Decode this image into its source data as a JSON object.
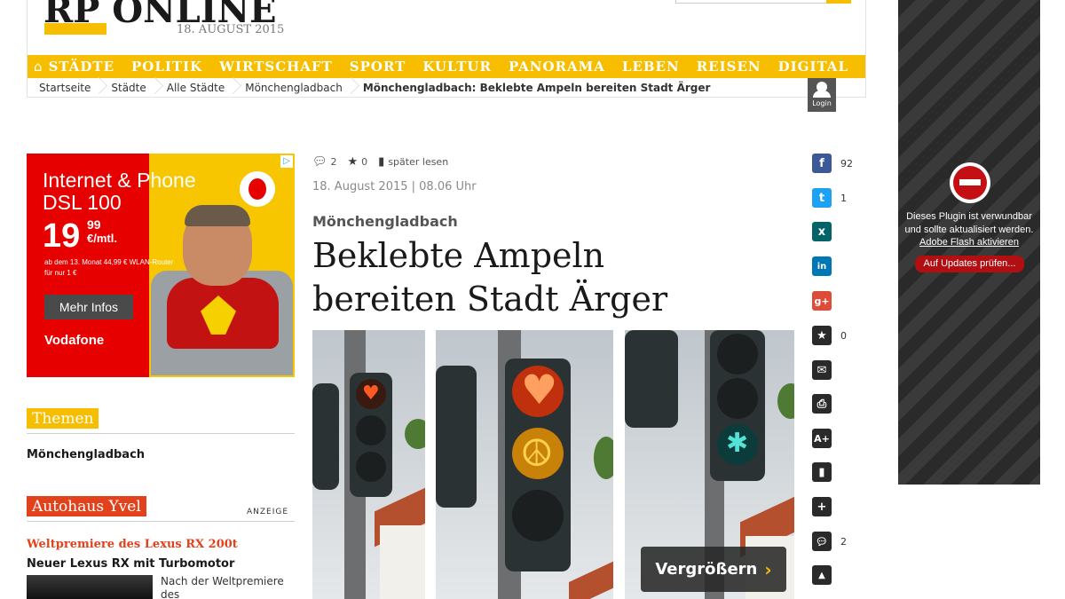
{
  "header": {
    "logo": "RP ONLINE",
    "date": "18. AUGUST 2015",
    "nav": [
      "STÄDTE",
      "POLITIK",
      "WIRTSCHAFT",
      "SPORT",
      "KULTUR",
      "PANORAMA",
      "LEBEN",
      "REISEN",
      "DIGITAL"
    ],
    "breadcrumb": [
      "Startseite",
      "Städte",
      "Alle Städte",
      "Mönchengladbach",
      "Mönchengladbach: Beklebte Ampeln bereiten Stadt Ärger"
    ],
    "login": "Login"
  },
  "ad": {
    "title": "Internet & Phone DSL 100",
    "price": "19",
    "cents": "99",
    "unit": "€/mtl.",
    "fineprint": "ab dem 13. Monat 44,99 € WLAN-Router für nur 1 €",
    "button": "Mehr Infos",
    "brand": "Vodafone"
  },
  "sidebar": {
    "themen_label": "Themen",
    "themen_link": "Mönchengladbach",
    "autohaus_label": "Autohaus Yvel",
    "anzeige": "ANZEIGE",
    "ad_title": "Weltpremiere des Lexus RX 200t",
    "ad_subtitle": "Neuer Lexus RX mit Turbomotor",
    "ad_text": "Nach der Weltpremiere des"
  },
  "article": {
    "comments": "2",
    "stars": "0",
    "read_later": "später lesen",
    "date": "18. August 2015 | 08.06 Uhr",
    "kicker": "Mönchengladbach",
    "headline": "Beklebte Ampeln bereiten Stadt Ärger",
    "enlarge": "Vergrößern"
  },
  "share": {
    "facebook_count": "92",
    "twitter_count": "1",
    "star_count": "0",
    "comment_count": "2"
  },
  "plugin": {
    "message": "Dieses Plugin ist verwundbar und sollte aktualisiert werden.",
    "link": "Adobe Flash aktivieren",
    "button": "Auf Updates prüfen..."
  },
  "colors": {
    "brand_yellow": "#f7be00",
    "accent_orange": "#e2421b",
    "vodafone_red": "#e60000"
  }
}
